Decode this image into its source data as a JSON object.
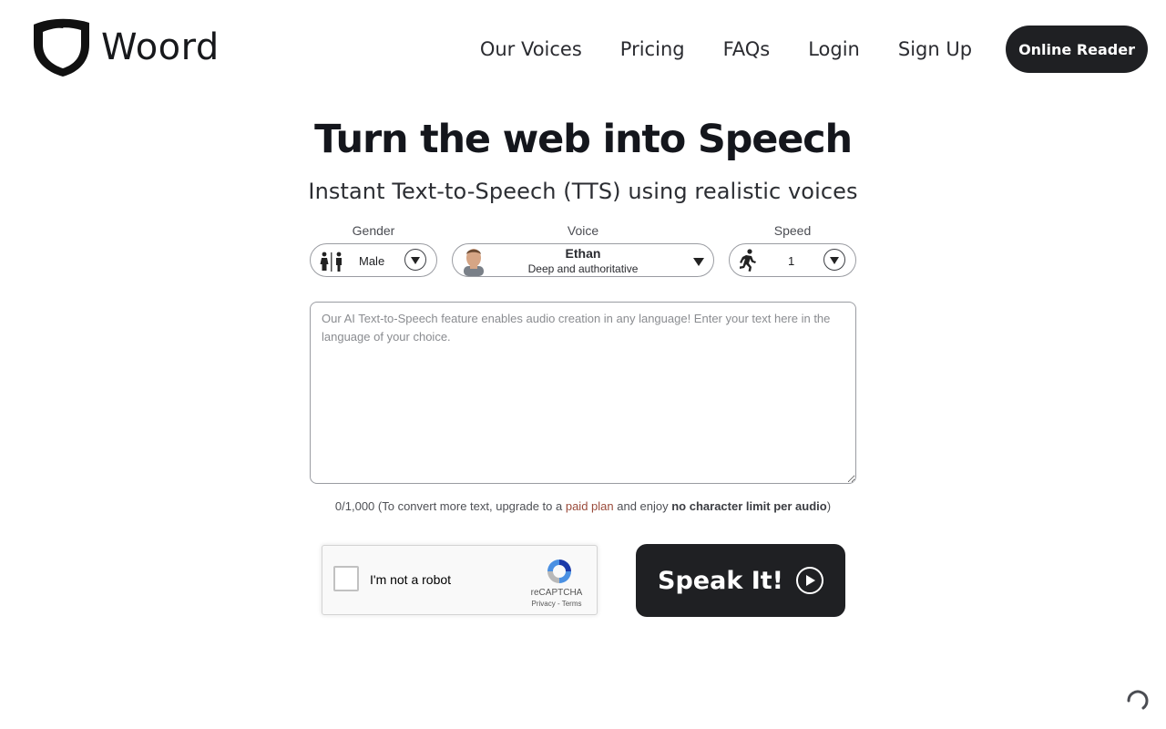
{
  "brand": {
    "name": "Woord"
  },
  "nav": {
    "items": [
      "Our Voices",
      "Pricing",
      "FAQs",
      "Login",
      "Sign Up"
    ],
    "cta": "Online Reader"
  },
  "hero": {
    "title": "Turn the web into Speech",
    "subtitle": "Instant Text-to-Speech (TTS) using realistic voices"
  },
  "controls": {
    "gender": {
      "label": "Gender",
      "value": "Male"
    },
    "voice": {
      "label": "Voice",
      "name": "Ethan",
      "description": "Deep and authoritative"
    },
    "speed": {
      "label": "Speed",
      "value": "1"
    }
  },
  "editor": {
    "placeholder": "Our AI Text-to-Speech feature enables audio creation in any language! Enter your text here in the language of your choice.",
    "value": ""
  },
  "counter": {
    "count": "0/1,000",
    "prefix": " (To convert more text, upgrade to a ",
    "link": "paid plan",
    "middle": " and enjoy ",
    "emphasis": "no character limit per audio",
    "suffix": ")"
  },
  "captcha": {
    "label": "I'm not a robot",
    "brand": "reCAPTCHA",
    "links": "Privacy - Terms"
  },
  "speak": {
    "label": "Speak It!"
  },
  "colors": {
    "primary": "#1f2023",
    "link": "#9a4a3a",
    "border": "#9a9ca2"
  },
  "icons": [
    "woord-shield-logo",
    "restroom-icon",
    "chevron-down-icon",
    "running-person-icon",
    "play-icon",
    "recaptcha-icon",
    "loading-spinner-icon"
  ]
}
